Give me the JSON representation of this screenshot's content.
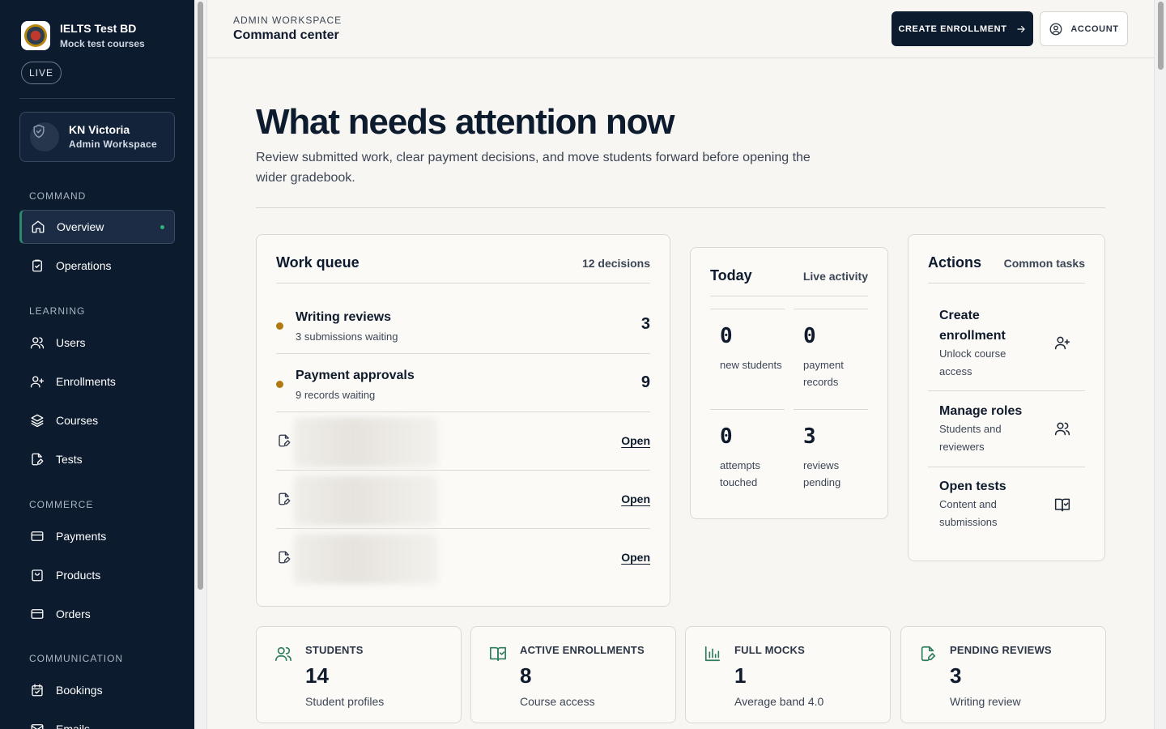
{
  "brand": {
    "title": "IELTS Test BD",
    "subtitle": "Mock test courses",
    "status": "LIVE"
  },
  "user": {
    "name": "KN Victoria",
    "role": "Admin Workspace"
  },
  "sidebar": {
    "sections": [
      {
        "label": "COMMAND"
      },
      {
        "label": "LEARNING"
      },
      {
        "label": "COMMERCE"
      },
      {
        "label": "COMMUNICATION"
      }
    ],
    "items": [
      {
        "label": "Overview",
        "icon": "home-icon",
        "active": true
      },
      {
        "label": "Operations",
        "icon": "clipboard-icon"
      },
      {
        "label": "Users",
        "icon": "users-icon"
      },
      {
        "label": "Enrollments",
        "icon": "user-plus-icon"
      },
      {
        "label": "Courses",
        "icon": "layers-icon"
      },
      {
        "label": "Tests",
        "icon": "file-edit-icon"
      },
      {
        "label": "Payments",
        "icon": "credit-card-icon"
      },
      {
        "label": "Products",
        "icon": "shopping-bag-icon"
      },
      {
        "label": "Orders",
        "icon": "credit-card-icon"
      },
      {
        "label": "Bookings",
        "icon": "calendar-icon"
      },
      {
        "label": "Emails",
        "icon": "mail-icon"
      }
    ]
  },
  "header": {
    "eyebrow": "ADMIN WORKSPACE",
    "title": "Command center",
    "primary_button": "CREATE ENROLLMENT",
    "secondary_button": "ACCOUNT"
  },
  "hero": {
    "title": "What needs attention now",
    "subtitle": "Review submitted work, clear payment decisions, and move students forward before opening the wider gradebook."
  },
  "work_queue": {
    "title": "Work queue",
    "meta": "12 decisions",
    "items": [
      {
        "title": "Writing reviews",
        "subtitle": "3 submissions waiting",
        "count": "3"
      },
      {
        "title": "Payment approvals",
        "subtitle": "9 records waiting",
        "count": "9"
      }
    ],
    "submissions": [
      {
        "action": "Open"
      },
      {
        "action": "Open"
      },
      {
        "action": "Open"
      }
    ]
  },
  "today": {
    "title": "Today",
    "meta": "Live activity",
    "stats": [
      {
        "value": "0",
        "label": "new students"
      },
      {
        "value": "0",
        "label": "payment records"
      },
      {
        "value": "0",
        "label": "attempts touched"
      },
      {
        "value": "3",
        "label": "reviews pending"
      }
    ]
  },
  "actions": {
    "title": "Actions",
    "meta": "Common tasks",
    "items": [
      {
        "title": "Create enrollment",
        "subtitle": "Unlock course access",
        "icon": "user-plus-icon"
      },
      {
        "title": "Manage roles",
        "subtitle": "Students and reviewers",
        "icon": "users-icon"
      },
      {
        "title": "Open tests",
        "subtitle": "Content and submissions",
        "icon": "book-check-icon"
      }
    ]
  },
  "kpis": [
    {
      "label": "STUDENTS",
      "value": "14",
      "subtitle": "Student profiles",
      "icon": "users-icon"
    },
    {
      "label": "ACTIVE ENROLLMENTS",
      "value": "8",
      "subtitle": "Course access",
      "icon": "book-check-icon"
    },
    {
      "label": "FULL MOCKS",
      "value": "1",
      "subtitle": "Average band 4.0",
      "icon": "bar-chart-icon"
    },
    {
      "label": "PENDING REVIEWS",
      "value": "3",
      "subtitle": "Writing review",
      "icon": "file-edit-icon"
    }
  ],
  "colors": {
    "sidebar": "#0d1b2f",
    "accent": "#2e8a6e",
    "warning_dot": "#b07a10",
    "kpi_icon": "#2e7d5e"
  }
}
